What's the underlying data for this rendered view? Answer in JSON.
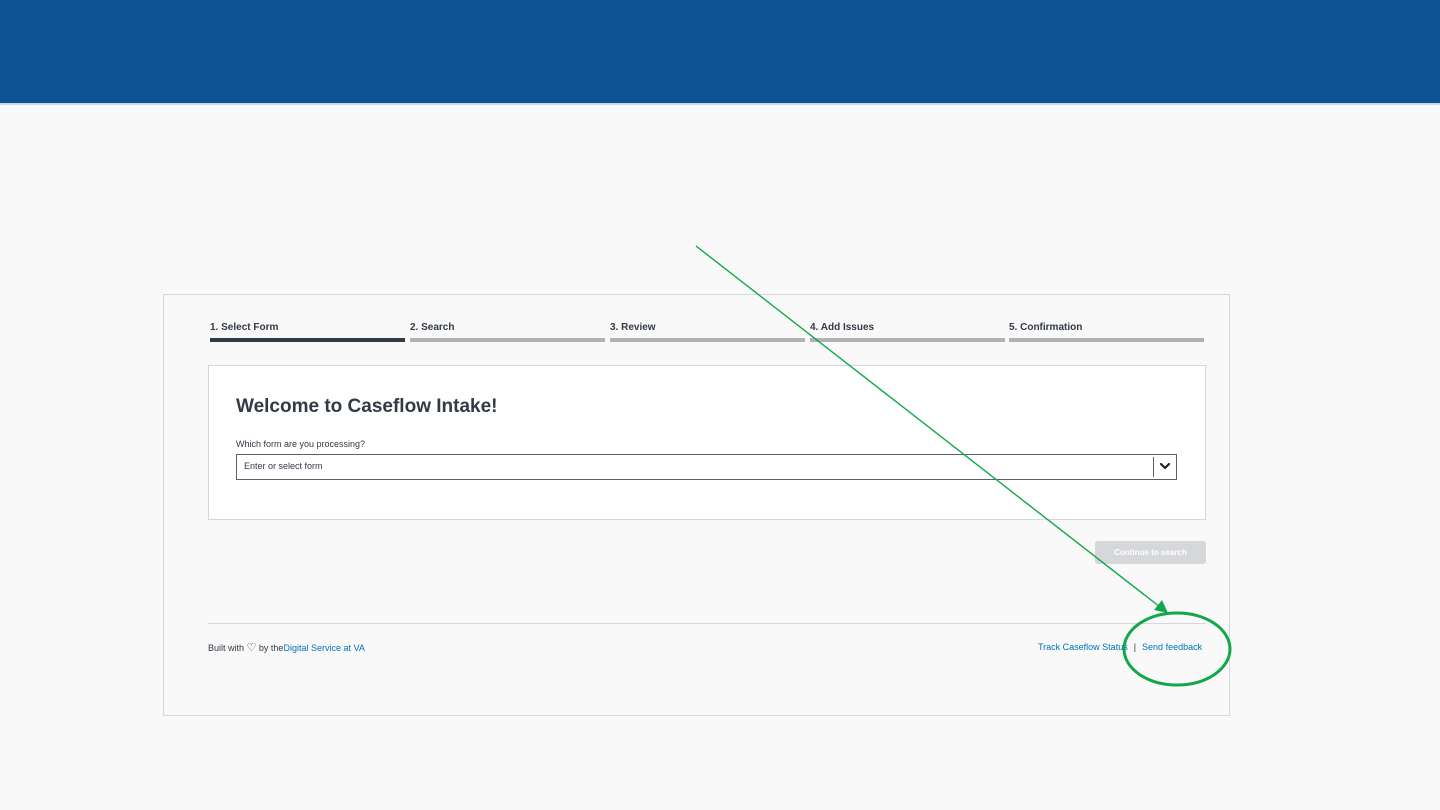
{
  "steps": [
    {
      "label": "1. Select Form",
      "current": true
    },
    {
      "label": "2. Search",
      "current": false
    },
    {
      "label": "3. Review",
      "current": false
    },
    {
      "label": "4. Add Issues",
      "current": false
    },
    {
      "label": "5. Confirmation",
      "current": false
    }
  ],
  "card": {
    "title": "Welcome to Caseflow Intake!",
    "field_label": "Which form are you processing?",
    "select_placeholder": "Enter or select form"
  },
  "actions": {
    "continue_label": "Continue to search"
  },
  "footer": {
    "built_with": "Built with",
    "heart_glyph": "♡",
    "by_the": "by the",
    "dsva_link": "Digital Service at VA",
    "track_status": "Track Caseflow Status",
    "separator": "|",
    "send_feedback": "Send feedback"
  },
  "colors": {
    "banner": "#0e5394",
    "annotation": "#12a84a",
    "link": "#0071bb",
    "step_active": "#323a45",
    "step_inactive": "#b1b1b1"
  },
  "icons": {
    "select_chevron": "chevron-down-icon",
    "heart": "heart-icon"
  }
}
